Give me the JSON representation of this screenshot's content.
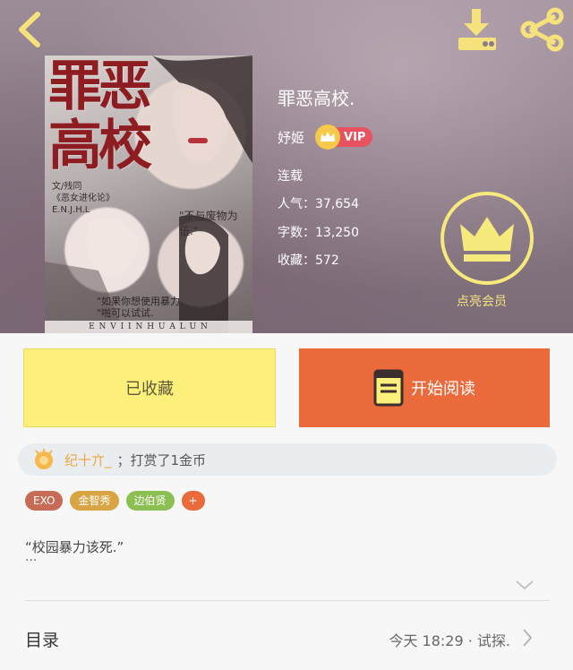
{
  "book": {
    "title": "罪恶高校.",
    "author": "妤姬",
    "vip_label": "VIP",
    "status": "连载",
    "popularity": "人气：37,654",
    "word_count": "字数：13,250",
    "favorites": "收藏：572"
  },
  "cover": {
    "title_text": "罪恶高校",
    "author_line1": "文/残同",
    "author_line2": "《恶女进化论》",
    "author_line3": "E.N.J.H.L",
    "quote1": "\"不与废物为伍.\"",
    "quote2_line1": "\"如果你想使用暴力.",
    "quote2_line2": "\"啪可以试试.",
    "bottom_text": "E N V I I N H U A L U N"
  },
  "member": {
    "label": "点亮会员"
  },
  "actions": {
    "collected_label": "已收藏",
    "read_label": "开始阅读"
  },
  "reward": {
    "user": "纪十亣_",
    "text": "；打赏了1金币"
  },
  "tags": [
    "EXO",
    "金智秀",
    "边伯贤"
  ],
  "tag_add": "+",
  "intro": {
    "line": "“校园暴力该死.”",
    "more": "···"
  },
  "catalog": {
    "label": "目录",
    "latest": "今天 18:29 · 试探."
  },
  "colors": {
    "accent_orange": "#ea6a3c",
    "collected_yellow": "#fdf07a",
    "member_gold": "#f7ea7c",
    "vip_red": "#e85260"
  },
  "icons": {
    "back": "chevron-left-icon",
    "download": "download-icon",
    "share": "share-icon",
    "member": "crown-icon",
    "read": "book-icon",
    "reward": "coin-hand-icon",
    "expand": "chevron-down-icon",
    "catalog": "chevron-right-icon"
  }
}
